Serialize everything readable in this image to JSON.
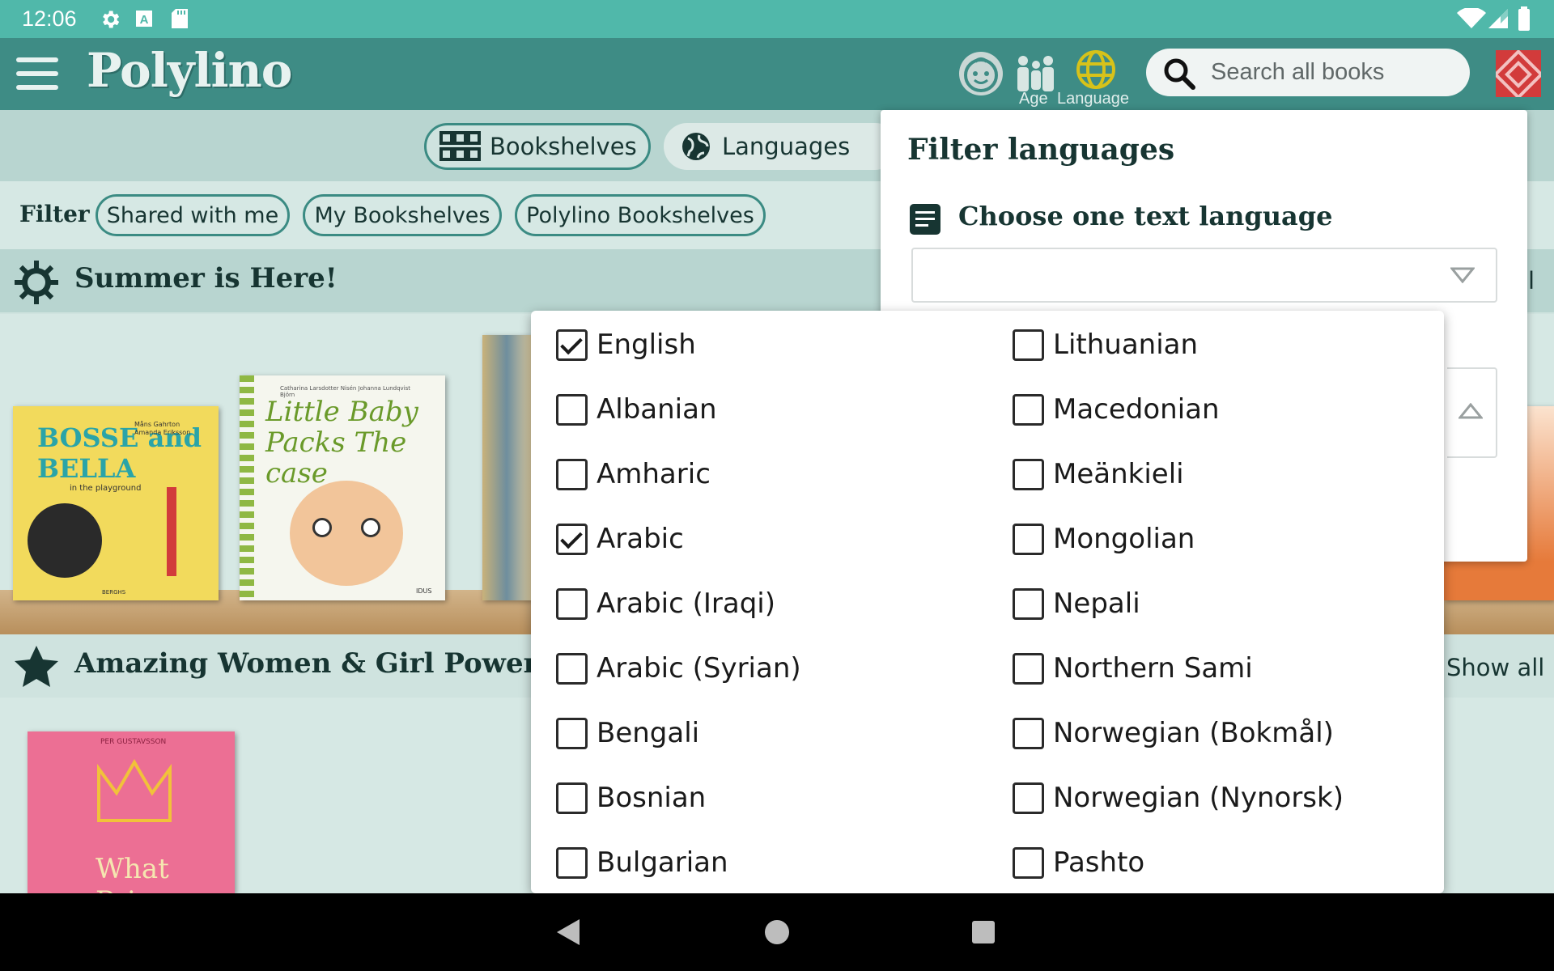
{
  "status_bar": {
    "time": "12:06"
  },
  "app_bar": {
    "logo": "Polylino",
    "age_label": "Age",
    "language_label": "Language",
    "search_placeholder": "Search all books"
  },
  "tabs": [
    {
      "label": "Bookshelves",
      "icon": "grid-icon"
    },
    {
      "label": "Languages",
      "icon": "globe-icon"
    }
  ],
  "filter": {
    "label": "Filter",
    "chips": [
      "Shared with me",
      "My Bookshelves",
      "Polylino Bookshelves"
    ]
  },
  "sections": [
    {
      "title": "Summer is Here!",
      "icon": "sun-icon",
      "action": "ll"
    },
    {
      "title": "Amazing Women & Girl Power",
      "icon": "star-icon",
      "action": "Show all"
    }
  ],
  "books": [
    {
      "title": "BOSSE and BELLA",
      "subtitle": "in the playground",
      "authors": "Måns Gahrton Amanda Eriksson",
      "publisher": "BERGHS"
    },
    {
      "title": "Little Baby Packs The case",
      "authors": "Catharina Larsdotter Nisén  Johanna Lundqvist Björn",
      "publisher": "IDUS"
    },
    {
      "title": "What Princess",
      "author": "PER GUSTAVSSON"
    }
  ],
  "filter_panel": {
    "title": "Filter languages",
    "subtitle": "Choose one text language",
    "select_value": ""
  },
  "language_options": {
    "left": [
      {
        "label": "English",
        "checked": true
      },
      {
        "label": "Albanian",
        "checked": false
      },
      {
        "label": "Amharic",
        "checked": false
      },
      {
        "label": "Arabic",
        "checked": true
      },
      {
        "label": "Arabic (Iraqi)",
        "checked": false
      },
      {
        "label": "Arabic (Syrian)",
        "checked": false
      },
      {
        "label": "Bengali",
        "checked": false
      },
      {
        "label": "Bosnian",
        "checked": false
      },
      {
        "label": "Bulgarian",
        "checked": false
      }
    ],
    "right": [
      {
        "label": "Lithuanian",
        "checked": false
      },
      {
        "label": "Macedonian",
        "checked": false
      },
      {
        "label": "Meänkieli",
        "checked": false
      },
      {
        "label": "Mongolian",
        "checked": false
      },
      {
        "label": "Nepali",
        "checked": false
      },
      {
        "label": "Northern Sami",
        "checked": false
      },
      {
        "label": "Norwegian (Bokmål)",
        "checked": false
      },
      {
        "label": "Norwegian (Nynorsk)",
        "checked": false
      },
      {
        "label": "Pashto",
        "checked": false
      }
    ]
  },
  "colors": {
    "primary": "#3e8c85",
    "status_bar": "#50b8aa",
    "accent_yellow": "#d7c21a"
  }
}
